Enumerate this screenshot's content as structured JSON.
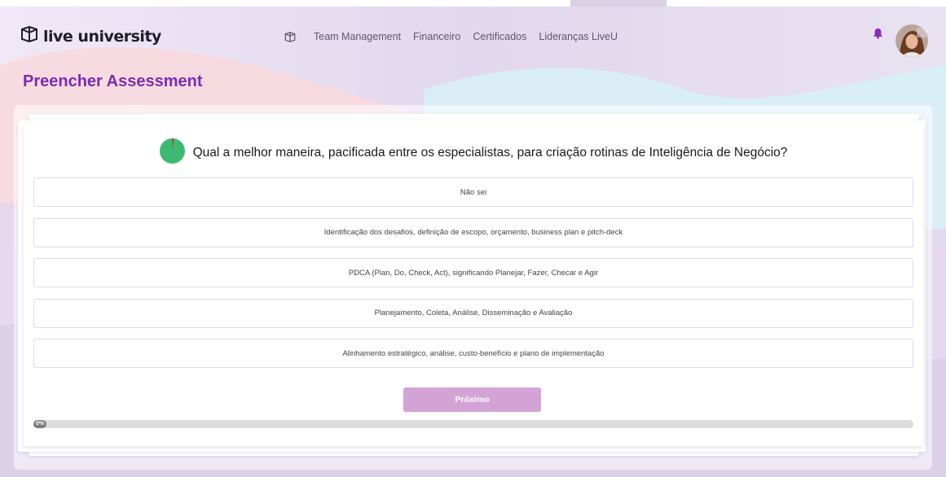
{
  "brand": {
    "name": "live university"
  },
  "nav": {
    "items": [
      {
        "label": "Team Management"
      },
      {
        "label": "Financeiro"
      },
      {
        "label": "Certificados"
      },
      {
        "label": "Lideranças LiveU"
      }
    ]
  },
  "page": {
    "title": "Preencher Assessment"
  },
  "question": {
    "text": "Qual a melhor maneira, pacificada entre os especialistas, para criação rotinas de Inteligência de Negócio?",
    "timer_color": "#3dba72"
  },
  "options": [
    {
      "label": "Não sei"
    },
    {
      "label": "Identificação dos desafios, definição de escopo, orçamento, business plan e pitch-deck"
    },
    {
      "label": "PDCA (Plan, Do, Check, Act), significando Planejar, Fazer, Checar e Agir"
    },
    {
      "label": "Planejamento, Coleta, Análise, Disseminação e Avaliação"
    },
    {
      "label": "Alinhamento estratégico, análise, custo-benefício e plano de implementação"
    }
  ],
  "actions": {
    "next_label": "Próximo"
  },
  "progress": {
    "label": "0%",
    "value": 0
  },
  "colors": {
    "accent": "#7a2db0",
    "button": "#d4a3d6",
    "bell": "#8a2bc2",
    "timer": "#3dba72"
  },
  "icons": {
    "logo": "book-cube-icon",
    "nav": "book-cube-icon",
    "notification": "bell-icon",
    "timer": "timer-pie-icon"
  }
}
